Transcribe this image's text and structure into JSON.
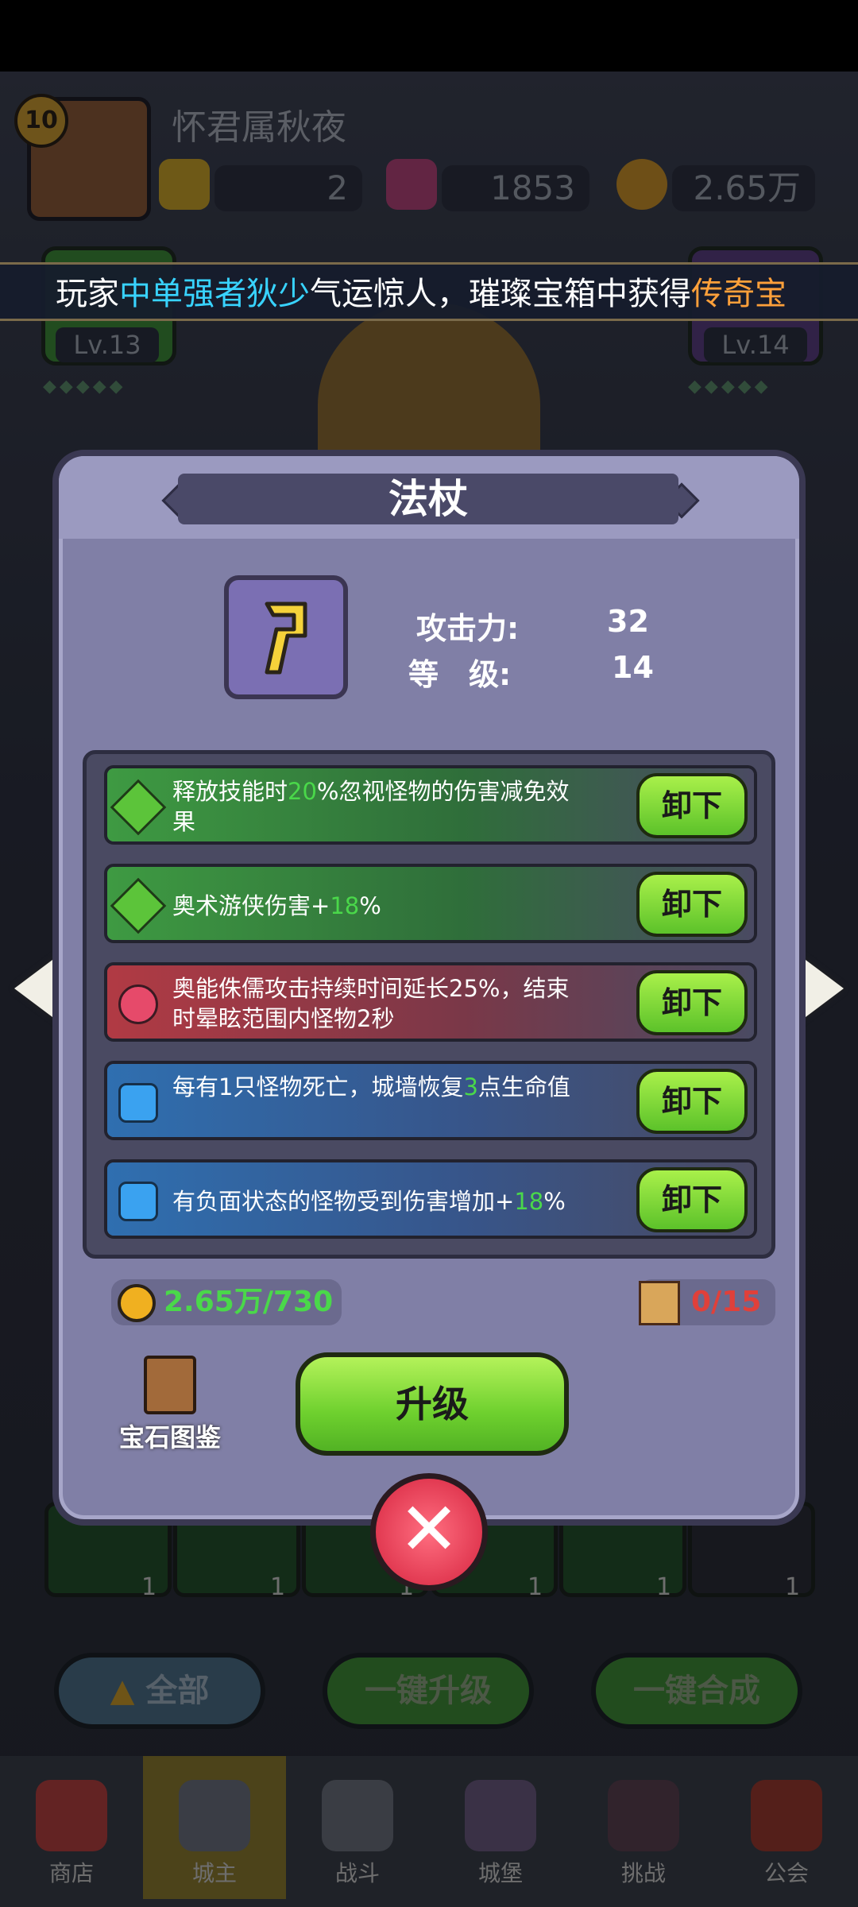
{
  "player": {
    "name": "怀君属秋夜",
    "level": "10"
  },
  "resources": {
    "gem_yellow": "2",
    "crystal_pink": "1853",
    "gold": "2.65万"
  },
  "ticker": {
    "prefix": "玩家",
    "player": "中单强者狄少",
    "middle": "气运惊人，璀璨宝箱中获得",
    "highlight": "传奇",
    "tail": "宝"
  },
  "side_cards": {
    "left_level": "Lv.13",
    "right_level": "Lv.14"
  },
  "panel": {
    "title": "法杖",
    "stats": {
      "attack_label": "攻击力:",
      "attack_value": "32",
      "level_label": "等　级:",
      "level_value": "14"
    },
    "affixes": [
      {
        "pre": "释放技能时",
        "num": "20",
        "post": "%忽视怪物的伤害减免效果",
        "color": "green",
        "button": "卸下"
      },
      {
        "pre": "奥术游侠伤害+",
        "num": "18",
        "post": "%",
        "color": "green",
        "button": "卸下"
      },
      {
        "pre": "奥能侏儒攻击持续时间延长25%，结束时晕眩范围内怪物2秒",
        "num": "",
        "post": "",
        "color": "red",
        "button": "卸下"
      },
      {
        "pre": "每有1只怪物死亡，城墙恢复",
        "num": "3",
        "post": "点生命值",
        "color": "blue",
        "button": "卸下"
      },
      {
        "pre": "有负面状态的怪物受到伤害增加+",
        "num": "18",
        "post": "%",
        "color": "blue",
        "button": "卸下"
      }
    ],
    "gold_cost": "2.65万/730",
    "scroll_cost": "0/15",
    "codex_label": "宝石图鉴",
    "upgrade_label": "升级"
  },
  "bottom_buttons": {
    "all": "全部",
    "upgrade_all": "一键升级",
    "merge_all": "一键合成"
  },
  "nav": [
    {
      "label": "商店"
    },
    {
      "label": "城主"
    },
    {
      "label": "战斗"
    },
    {
      "label": "城堡"
    },
    {
      "label": "挑战"
    },
    {
      "label": "公会"
    }
  ],
  "slot_counts": [
    "1",
    "1",
    "1",
    "1",
    "1",
    "1"
  ]
}
